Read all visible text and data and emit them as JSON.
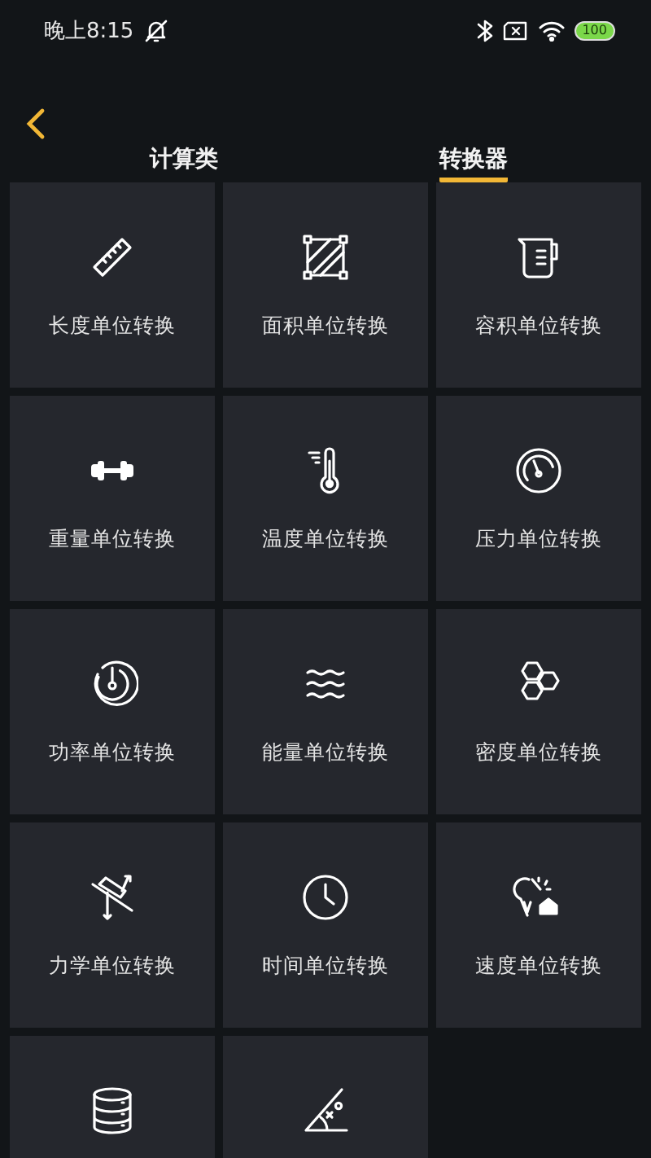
{
  "status_bar": {
    "time": "晚上8:15",
    "battery": "100"
  },
  "tabs": [
    {
      "label": "计算类",
      "selected": false
    },
    {
      "label": "转换器",
      "selected": true
    }
  ],
  "items": [
    {
      "kind": "labeled",
      "label": "长度单位转换"
    },
    {
      "kind": "labeled",
      "label": "面积单位转换"
    },
    {
      "kind": "labeled",
      "label": "容积单位转换"
    },
    {
      "kind": "labeled",
      "label": "重量单位转换"
    },
    {
      "kind": "labeled",
      "label": "温度单位转换"
    },
    {
      "kind": "labeled",
      "label": "压力单位转换"
    },
    {
      "kind": "labeled",
      "label": "功率单位转换"
    },
    {
      "kind": "labeled",
      "label": "能量单位转换"
    },
    {
      "kind": "labeled",
      "label": "密度单位转换"
    },
    {
      "kind": "labeled",
      "label": "力学单位转换"
    },
    {
      "kind": "labeled",
      "label": "时间单位转换"
    },
    {
      "kind": "labeled",
      "label": "速度单位转换"
    },
    {
      "kind": "icon_only"
    },
    {
      "kind": "icon_only"
    }
  ]
}
